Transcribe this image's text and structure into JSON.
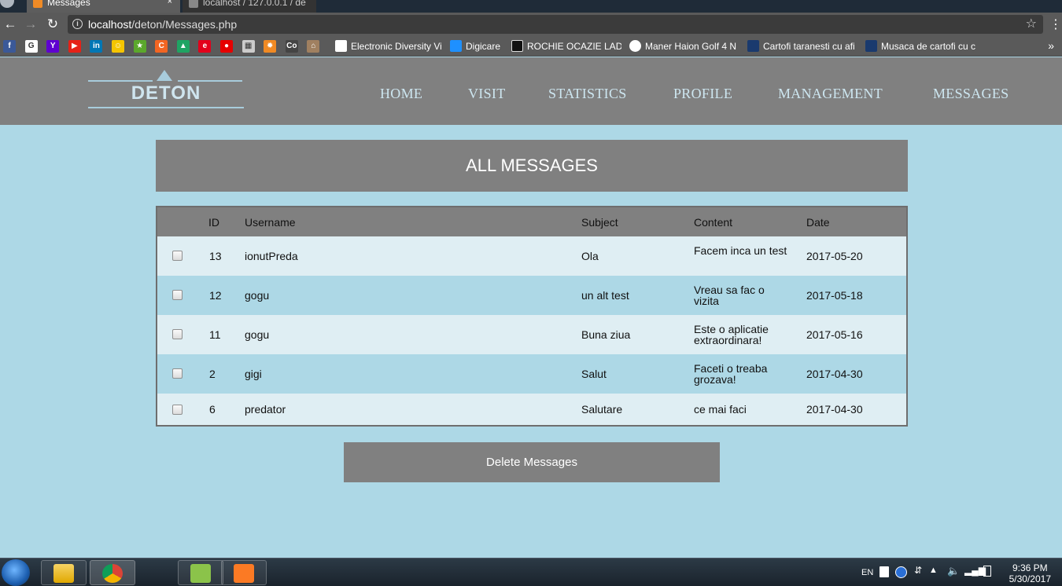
{
  "browser": {
    "tabs": [
      {
        "label": "Messages",
        "close": "×"
      },
      {
        "label": "localhost / 127.0.0.1 / de"
      }
    ],
    "url_host": "localhost",
    "url_path": "/deton/Messages.php",
    "back": "←",
    "forward": "→",
    "reload": "↻",
    "star": "☆",
    "menu": "⋮",
    "bookmarks": [
      {
        "label": "Electronic Diversity Vi"
      },
      {
        "label": "Digicare"
      },
      {
        "label": "ROCHIE OCAZIE LADY"
      },
      {
        "label": "Maner Haion Golf 4 N"
      },
      {
        "label": "Cartofi taranesti cu afi"
      },
      {
        "label": "Musaca de cartofi cu c"
      }
    ],
    "bookmark_icons": [
      {
        "name": "facebook",
        "glyph": "f",
        "color": "#3b5998"
      },
      {
        "name": "google",
        "glyph": "G",
        "color": "#ffffff"
      },
      {
        "name": "yahoo",
        "glyph": "Y",
        "color": "#5f01d1"
      },
      {
        "name": "youtube",
        "glyph": "▶",
        "color": "#e62117"
      },
      {
        "name": "linkedin",
        "glyph": "in",
        "color": "#0077b5"
      },
      {
        "name": "smiley",
        "glyph": "☺",
        "color": "#f5c500"
      },
      {
        "name": "star",
        "glyph": "★",
        "color": "#5ba82c"
      },
      {
        "name": "c-circle",
        "glyph": "C",
        "color": "#f26522"
      },
      {
        "name": "drive",
        "glyph": "▲",
        "color": "#1fa463"
      },
      {
        "name": "e-red",
        "glyph": "e",
        "color": "#e3001b"
      },
      {
        "name": "vodafone",
        "glyph": "●",
        "color": "#e60000"
      },
      {
        "name": "document",
        "glyph": "▦",
        "color": "#cccccc"
      },
      {
        "name": "sun",
        "glyph": "✹",
        "color": "#f08a24"
      },
      {
        "name": "co",
        "glyph": "Co",
        "color": "#444444"
      },
      {
        "name": "house",
        "glyph": "⌂",
        "color": "#a08060"
      }
    ],
    "bookmarks_more": "»"
  },
  "site": {
    "logo_text": "DETON",
    "nav": [
      "HOME",
      "VISIT",
      "STATISTICS",
      "PROFILE",
      "MANAGEMENT",
      "MESSAGES"
    ]
  },
  "messages": {
    "title": "ALL MESSAGES",
    "columns": [
      "ID",
      "Username",
      "Subject",
      "Content",
      "Date"
    ],
    "rows": [
      {
        "id": "13",
        "username": "ionutPreda",
        "subject": "Ola",
        "content": "Facem inca un test",
        "date": "2017-05-20"
      },
      {
        "id": "12",
        "username": "gogu",
        "subject": "un alt test",
        "content": "Vreau sa fac o vizita",
        "date": "2017-05-18"
      },
      {
        "id": "11",
        "username": "gogu",
        "subject": "Buna ziua",
        "content": "Este o aplicatie extraordinara!",
        "date": "2017-05-16"
      },
      {
        "id": "2",
        "username": "gigi",
        "subject": "Salut",
        "content": "Faceti o treaba grozava!",
        "date": "2017-04-30"
      },
      {
        "id": "6",
        "username": "predator",
        "subject": "Salutare",
        "content": "ce mai faci",
        "date": "2017-04-30"
      }
    ],
    "delete_label": "Delete Messages"
  },
  "taskbar": {
    "lang": "EN",
    "time": "9:36 PM",
    "date": "5/30/2017"
  }
}
